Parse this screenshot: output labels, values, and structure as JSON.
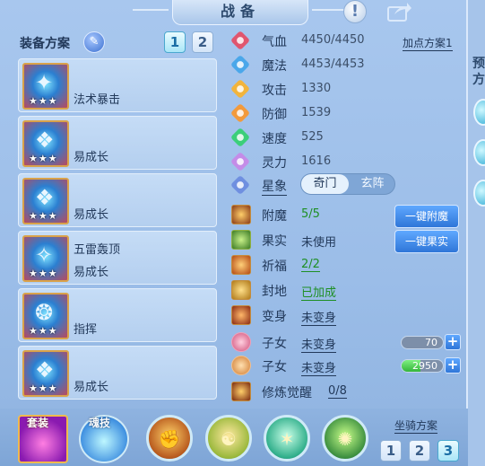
{
  "header": {
    "title": "战备",
    "help_glyph": "!"
  },
  "equip_scheme": {
    "label": "装备方案",
    "tabs": [
      "1",
      "2"
    ],
    "active_tab": 0
  },
  "equip_slots": [
    {
      "name": "法术暴击",
      "stars": "★★★",
      "glyph": "✦"
    },
    {
      "name": "易成长",
      "stars": "★★★",
      "glyph": "❖"
    },
    {
      "name": "易成长",
      "stars": "★★★",
      "glyph": "❖"
    },
    {
      "name": "五雷轰顶",
      "sub": "易成长",
      "stars": "★★★",
      "glyph": "✧"
    },
    {
      "name": "指挥",
      "stars": "★★★",
      "glyph": "❂"
    },
    {
      "name": "易成长",
      "stars": "★★★",
      "glyph": "❖"
    }
  ],
  "add_scheme": "加点方案1",
  "stats": [
    {
      "name": "气血",
      "value": "4450/4450",
      "color": "#e0566f"
    },
    {
      "name": "魔法",
      "value": "4453/4453",
      "color": "#4aa7ea"
    },
    {
      "name": "攻击",
      "value": "1330",
      "color": "#f2b43c"
    },
    {
      "name": "防御",
      "value": "1539",
      "color": "#f29a3c"
    },
    {
      "name": "速度",
      "value": "525",
      "color": "#3ccf7a"
    },
    {
      "name": "灵力",
      "value": "1616",
      "color": "#c48ce8"
    }
  ],
  "star_row": {
    "name": "星象",
    "toggle": [
      "奇门",
      "玄阵"
    ]
  },
  "effects": [
    {
      "name": "附魔",
      "value": "5/5",
      "style": "green"
    },
    {
      "name": "果实",
      "value": "未使用",
      "style": "plain"
    },
    {
      "name": "祈福",
      "value": "2/2",
      "style": "green-under"
    },
    {
      "name": "封地",
      "value": "已加成",
      "style": "green-under"
    },
    {
      "name": "变身",
      "value": "未变身",
      "style": "under"
    },
    {
      "name": "子女",
      "value": "未变身",
      "style": "under"
    },
    {
      "name": "子女",
      "value": "未变身",
      "style": "under"
    },
    {
      "name": "修炼觉醒",
      "value": "0/8",
      "style": "under"
    }
  ],
  "buttons": {
    "enchant": "一键附魔",
    "fruit": "一键果实",
    "plus": "+"
  },
  "child_bars": [
    {
      "value": "70",
      "fill": 0.0
    },
    {
      "value": "2950",
      "fill": 0.45
    }
  ],
  "bottom": {
    "suit_label": "套装",
    "soul_label": "魂技",
    "mount_label": "坐骑方案",
    "mount_tabs": [
      "1",
      "2",
      "3"
    ],
    "active_mount_tab": 2
  },
  "right_strip": {
    "chars": [
      "预",
      "方"
    ]
  }
}
